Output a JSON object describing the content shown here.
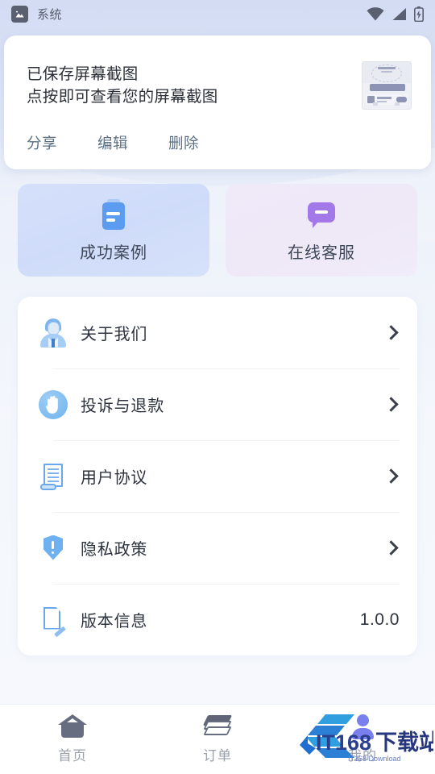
{
  "status_bar": {
    "app_icon": "image-icon",
    "app_name": "系统",
    "wifi_icon": "wifi-icon",
    "signal_icon": "signal-icon",
    "battery_icon": "battery-charging-icon"
  },
  "notification": {
    "title": "已保存屏幕截图",
    "subtitle": "点按即可查看您的屏幕截图",
    "thumbnail_icon": "screenshot-thumbnail",
    "actions": [
      {
        "label": "分享",
        "name": "share"
      },
      {
        "label": "编辑",
        "name": "edit"
      },
      {
        "label": "删除",
        "name": "delete"
      }
    ]
  },
  "quick_cards": [
    {
      "label": "成功案例",
      "icon": "document-icon",
      "color": "#5b9cf0"
    },
    {
      "label": "在线客服",
      "icon": "chat-bubble-icon",
      "color": "#a379ea"
    }
  ],
  "menu": {
    "items": [
      {
        "label": "关于我们",
        "icon": "person-icon",
        "value": "",
        "chevron": true
      },
      {
        "label": "投诉与退款",
        "icon": "hand-icon",
        "value": "",
        "chevron": true
      },
      {
        "label": "用户协议",
        "icon": "agreement-icon",
        "value": "",
        "chevron": true
      },
      {
        "label": "隐私政策",
        "icon": "shield-icon",
        "value": "",
        "chevron": true
      },
      {
        "label": "版本信息",
        "icon": "version-icon",
        "value": "1.0.0",
        "chevron": false
      }
    ]
  },
  "tabbar": {
    "tabs": [
      {
        "label": "首页",
        "icon": "home-icon",
        "active": false
      },
      {
        "label": "订单",
        "icon": "orders-icon",
        "active": false
      },
      {
        "label": "我的",
        "icon": "profile-icon",
        "active": true
      }
    ]
  },
  "watermark": {
    "text": "IT168下载站",
    "subtext": "IT168 Download"
  },
  "colors": {
    "accent_blue": "#5b9cf0",
    "accent_purple": "#a379ea",
    "text_primary": "#2e3340",
    "text_muted": "#9aa0ac",
    "watermark_blue": "#2f9fe0",
    "watermark_navy": "#2b55c4"
  }
}
